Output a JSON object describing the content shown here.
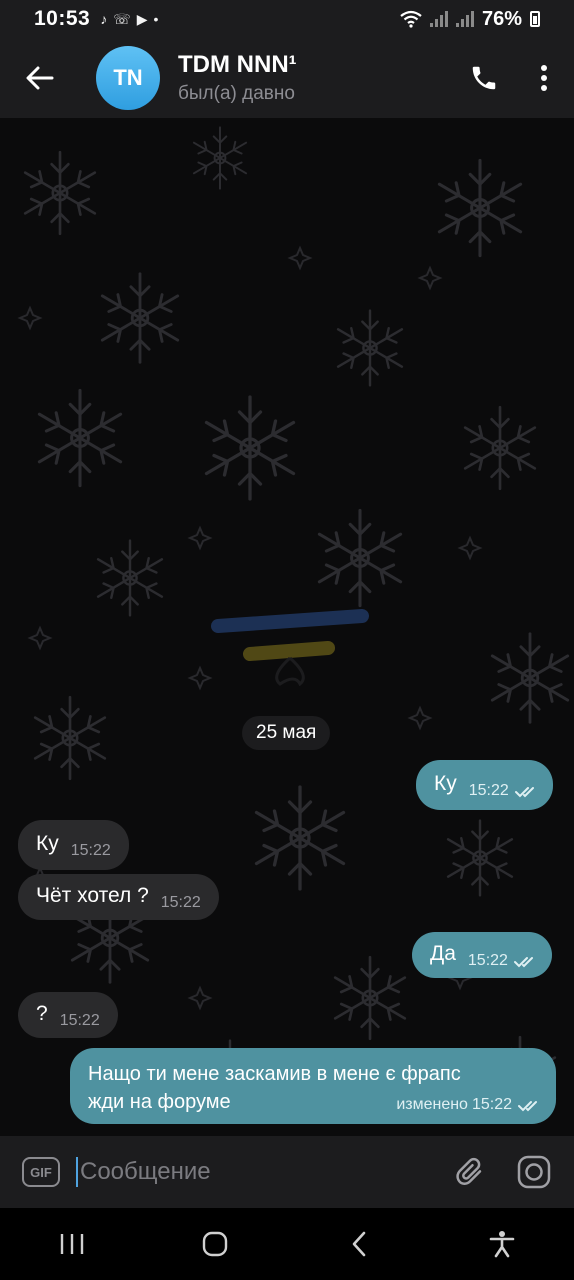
{
  "status": {
    "time": "10:53",
    "battery": "76%"
  },
  "header": {
    "avatar_initials": "TN",
    "title": "TDM NNN¹",
    "subtitle": "был(а) давно"
  },
  "chat": {
    "date_label": "25 мая",
    "messages": [
      {
        "direction": "out",
        "text": "Ку",
        "time": "15:22",
        "read": true
      },
      {
        "direction": "in",
        "text": "Ку",
        "time": "15:22"
      },
      {
        "direction": "in",
        "text": "Чёт хотел ?",
        "time": "15:22"
      },
      {
        "direction": "out",
        "text": "Да",
        "time": "15:22",
        "read": true
      },
      {
        "direction": "in",
        "text": "?",
        "time": "15:22"
      },
      {
        "direction": "out",
        "text_line1": "Нащо ти мене заскамив в мене є фрапс",
        "text_line2": "жди на форуме",
        "edited_label": "изменено",
        "time": "15:22",
        "read": true
      }
    ]
  },
  "input": {
    "gif_label": "GIF",
    "placeholder": "Сообщение"
  },
  "colors": {
    "outgoing_bubble": "#4f92a0",
    "incoming_bubble": "#2a2a2c",
    "header_bg": "#1c1c1e",
    "avatar": "#3aa6e6"
  }
}
